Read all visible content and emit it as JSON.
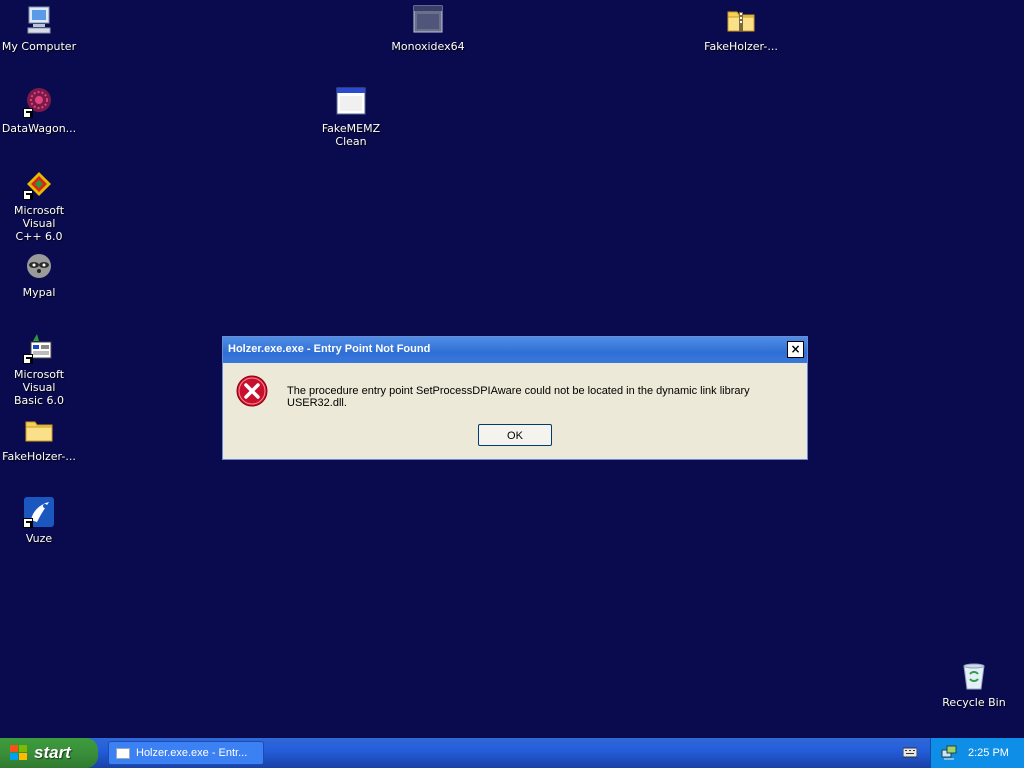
{
  "desktop": {
    "icons": {
      "my_computer": "My Computer",
      "datawagon": "DataWagon...",
      "msvc": "Microsoft Visual\nC++ 6.0",
      "mypal": "Mypal",
      "msvb": "Microsoft Visual\nBasic 6.0",
      "fakeholzer_left": "FakeHolzer-...",
      "vuze": "Vuze",
      "monoxidex64": "Monoxidex64",
      "fakememz": "FakeMEMZ\nClean",
      "fakeholzer_right": "FakeHolzer-...",
      "recycle_bin": "Recycle Bin"
    }
  },
  "dialog": {
    "title": "Holzer.exe.exe - Entry Point Not Found",
    "close_label": "×",
    "message": "The procedure entry point SetProcessDPIAware could not be located in the dynamic link library USER32.dll.",
    "ok_label": "OK"
  },
  "taskbar": {
    "start_label": "start",
    "task_label": "Holzer.exe.exe - Entr...",
    "clock": "2:25 PM"
  },
  "colors": {
    "desktop_bg": "#0a0b4f",
    "taskbar": "#245edb",
    "start_green": "#3a8f3a",
    "error_red": "#c8102e"
  }
}
